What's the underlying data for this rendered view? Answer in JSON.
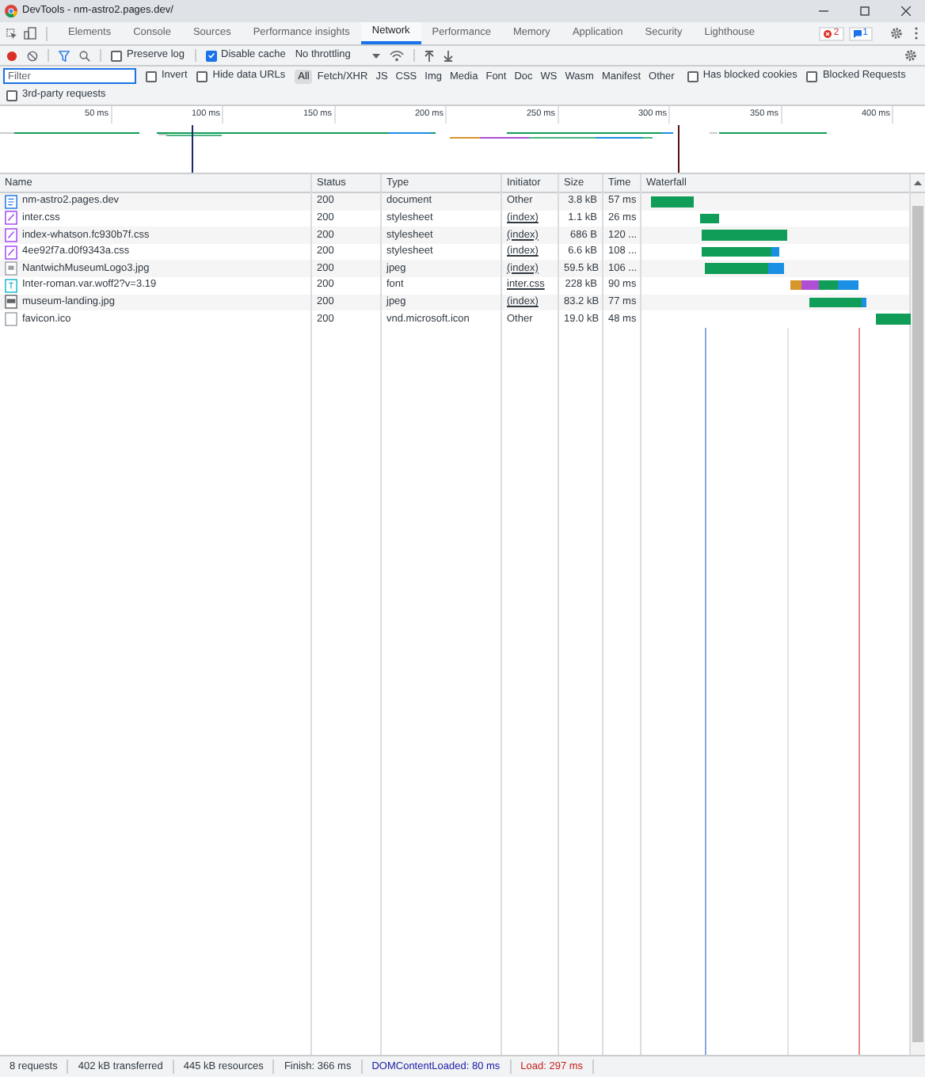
{
  "window": {
    "title": "DevTools - nm-astro2.pages.dev/"
  },
  "tabs": [
    {
      "label": "Elements",
      "selected": false
    },
    {
      "label": "Console",
      "selected": false
    },
    {
      "label": "Sources",
      "selected": false
    },
    {
      "label": "Performance insights",
      "selected": false
    },
    {
      "label": "Network",
      "selected": true
    },
    {
      "label": "Performance",
      "selected": false
    },
    {
      "label": "Memory",
      "selected": false
    },
    {
      "label": "Application",
      "selected": false
    },
    {
      "label": "Security",
      "selected": false
    },
    {
      "label": "Lighthouse",
      "selected": false
    }
  ],
  "badges": {
    "errors": "2",
    "messages": "1"
  },
  "toolbar": {
    "recording": true,
    "preserve_log": {
      "label": "Preserve log",
      "checked": false
    },
    "disable_cache": {
      "label": "Disable cache",
      "checked": true
    },
    "throttling": "No throttling"
  },
  "filter_bar": {
    "placeholder": "Filter",
    "invert": {
      "label": "Invert",
      "checked": false
    },
    "hide_data_urls": {
      "label": "Hide data URLs",
      "checked": false
    },
    "types": [
      {
        "label": "All",
        "selected": true
      },
      {
        "label": "Fetch/XHR",
        "selected": false
      },
      {
        "label": "JS",
        "selected": false
      },
      {
        "label": "CSS",
        "selected": false
      },
      {
        "label": "Img",
        "selected": false
      },
      {
        "label": "Media",
        "selected": false
      },
      {
        "label": "Font",
        "selected": false
      },
      {
        "label": "Doc",
        "selected": false
      },
      {
        "label": "WS",
        "selected": false
      },
      {
        "label": "Wasm",
        "selected": false
      },
      {
        "label": "Manifest",
        "selected": false
      },
      {
        "label": "Other",
        "selected": false
      }
    ],
    "has_blocked_cookies": {
      "label": "Has blocked cookies",
      "checked": false
    },
    "blocked_requests": {
      "label": "Blocked Requests",
      "checked": false
    },
    "third_party": {
      "label": "3rd-party requests",
      "checked": false
    }
  },
  "overview": {
    "ticks": [
      "50 ms",
      "100 ms",
      "150 ms",
      "200 ms",
      "250 ms",
      "300 ms",
      "350 ms",
      "400 ms"
    ]
  },
  "table": {
    "columns": [
      "Name",
      "Status",
      "Type",
      "Initiator",
      "Size",
      "Time",
      "Waterfall"
    ],
    "rows": [
      {
        "name": "nm-astro2.pages.dev",
        "kind": "document",
        "status": "200",
        "type": "document",
        "initiator": "Other",
        "initiator_link": false,
        "size": "3.8 kB",
        "time": "57 ms"
      },
      {
        "name": "inter.css",
        "kind": "stylesheet",
        "status": "200",
        "type": "stylesheet",
        "initiator": "(index)",
        "initiator_link": true,
        "size": "1.1 kB",
        "time": "26 ms"
      },
      {
        "name": "index-whatson.fc930b7f.css",
        "kind": "stylesheet",
        "status": "200",
        "type": "stylesheet",
        "initiator": "(index)",
        "initiator_link": true,
        "size": "686 B",
        "time": "120 ..."
      },
      {
        "name": "4ee92f7a.d0f9343a.css",
        "kind": "stylesheet",
        "status": "200",
        "type": "stylesheet",
        "initiator": "(index)",
        "initiator_link": true,
        "size": "6.6 kB",
        "time": "108 ..."
      },
      {
        "name": "NantwichMuseumLogo3.jpg",
        "kind": "image",
        "status": "200",
        "type": "jpeg",
        "initiator": "(index)",
        "initiator_link": true,
        "size": "59.5 kB",
        "time": "106 ..."
      },
      {
        "name": "Inter-roman.var.woff2?v=3.19",
        "kind": "font",
        "status": "200",
        "type": "font",
        "initiator": "inter.css",
        "initiator_link": true,
        "size": "228 kB",
        "time": "90 ms"
      },
      {
        "name": "museum-landing.jpg",
        "kind": "photo",
        "status": "200",
        "type": "jpeg",
        "initiator": "(index)",
        "initiator_link": true,
        "size": "83.2 kB",
        "time": "77 ms"
      },
      {
        "name": "favicon.ico",
        "kind": "other",
        "status": "200",
        "type": "vnd.microsoft.icon",
        "initiator": "Other",
        "initiator_link": false,
        "size": "19.0 kB",
        "time": "48 ms"
      }
    ]
  },
  "status_bar": [
    {
      "text": "8 requests",
      "kind": "plain"
    },
    {
      "text": "402 kB transferred",
      "kind": "plain"
    },
    {
      "text": "445 kB resources",
      "kind": "plain"
    },
    {
      "text": "Finish: 366 ms",
      "kind": "plain"
    },
    {
      "text": "DOMContentLoaded: 80 ms",
      "kind": "dom"
    },
    {
      "text": "Load: 297 ms",
      "kind": "load"
    }
  ]
}
